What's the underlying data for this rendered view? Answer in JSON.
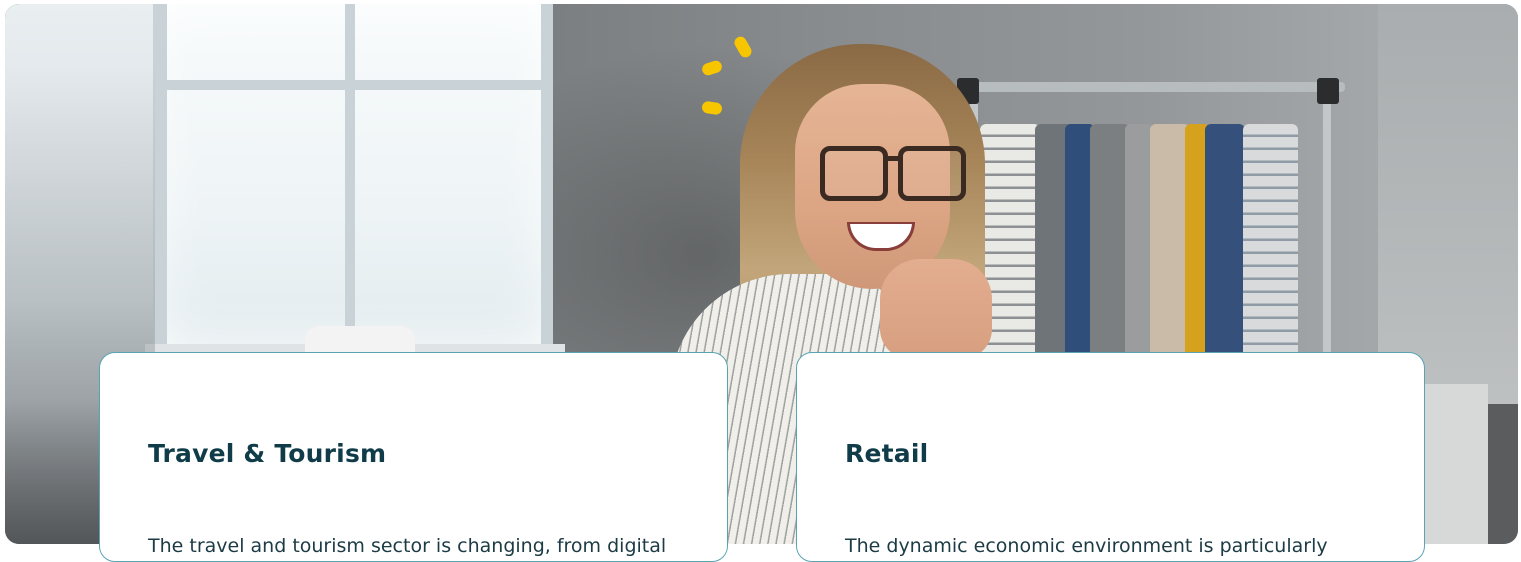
{
  "hero_image": {
    "icon": "woman-smiling-with-clothes-rack-photo",
    "accent_color": "#f7c600"
  },
  "cards": [
    {
      "title": "Travel & Tourism",
      "text": "The travel and tourism sector is changing, from digital"
    },
    {
      "title": "Retail",
      "text": "The dynamic economic environment is particularly"
    }
  ],
  "colors": {
    "card_border": "#5aa3b3",
    "title_color": "#0f3c48",
    "text_color": "#1c3b45"
  }
}
